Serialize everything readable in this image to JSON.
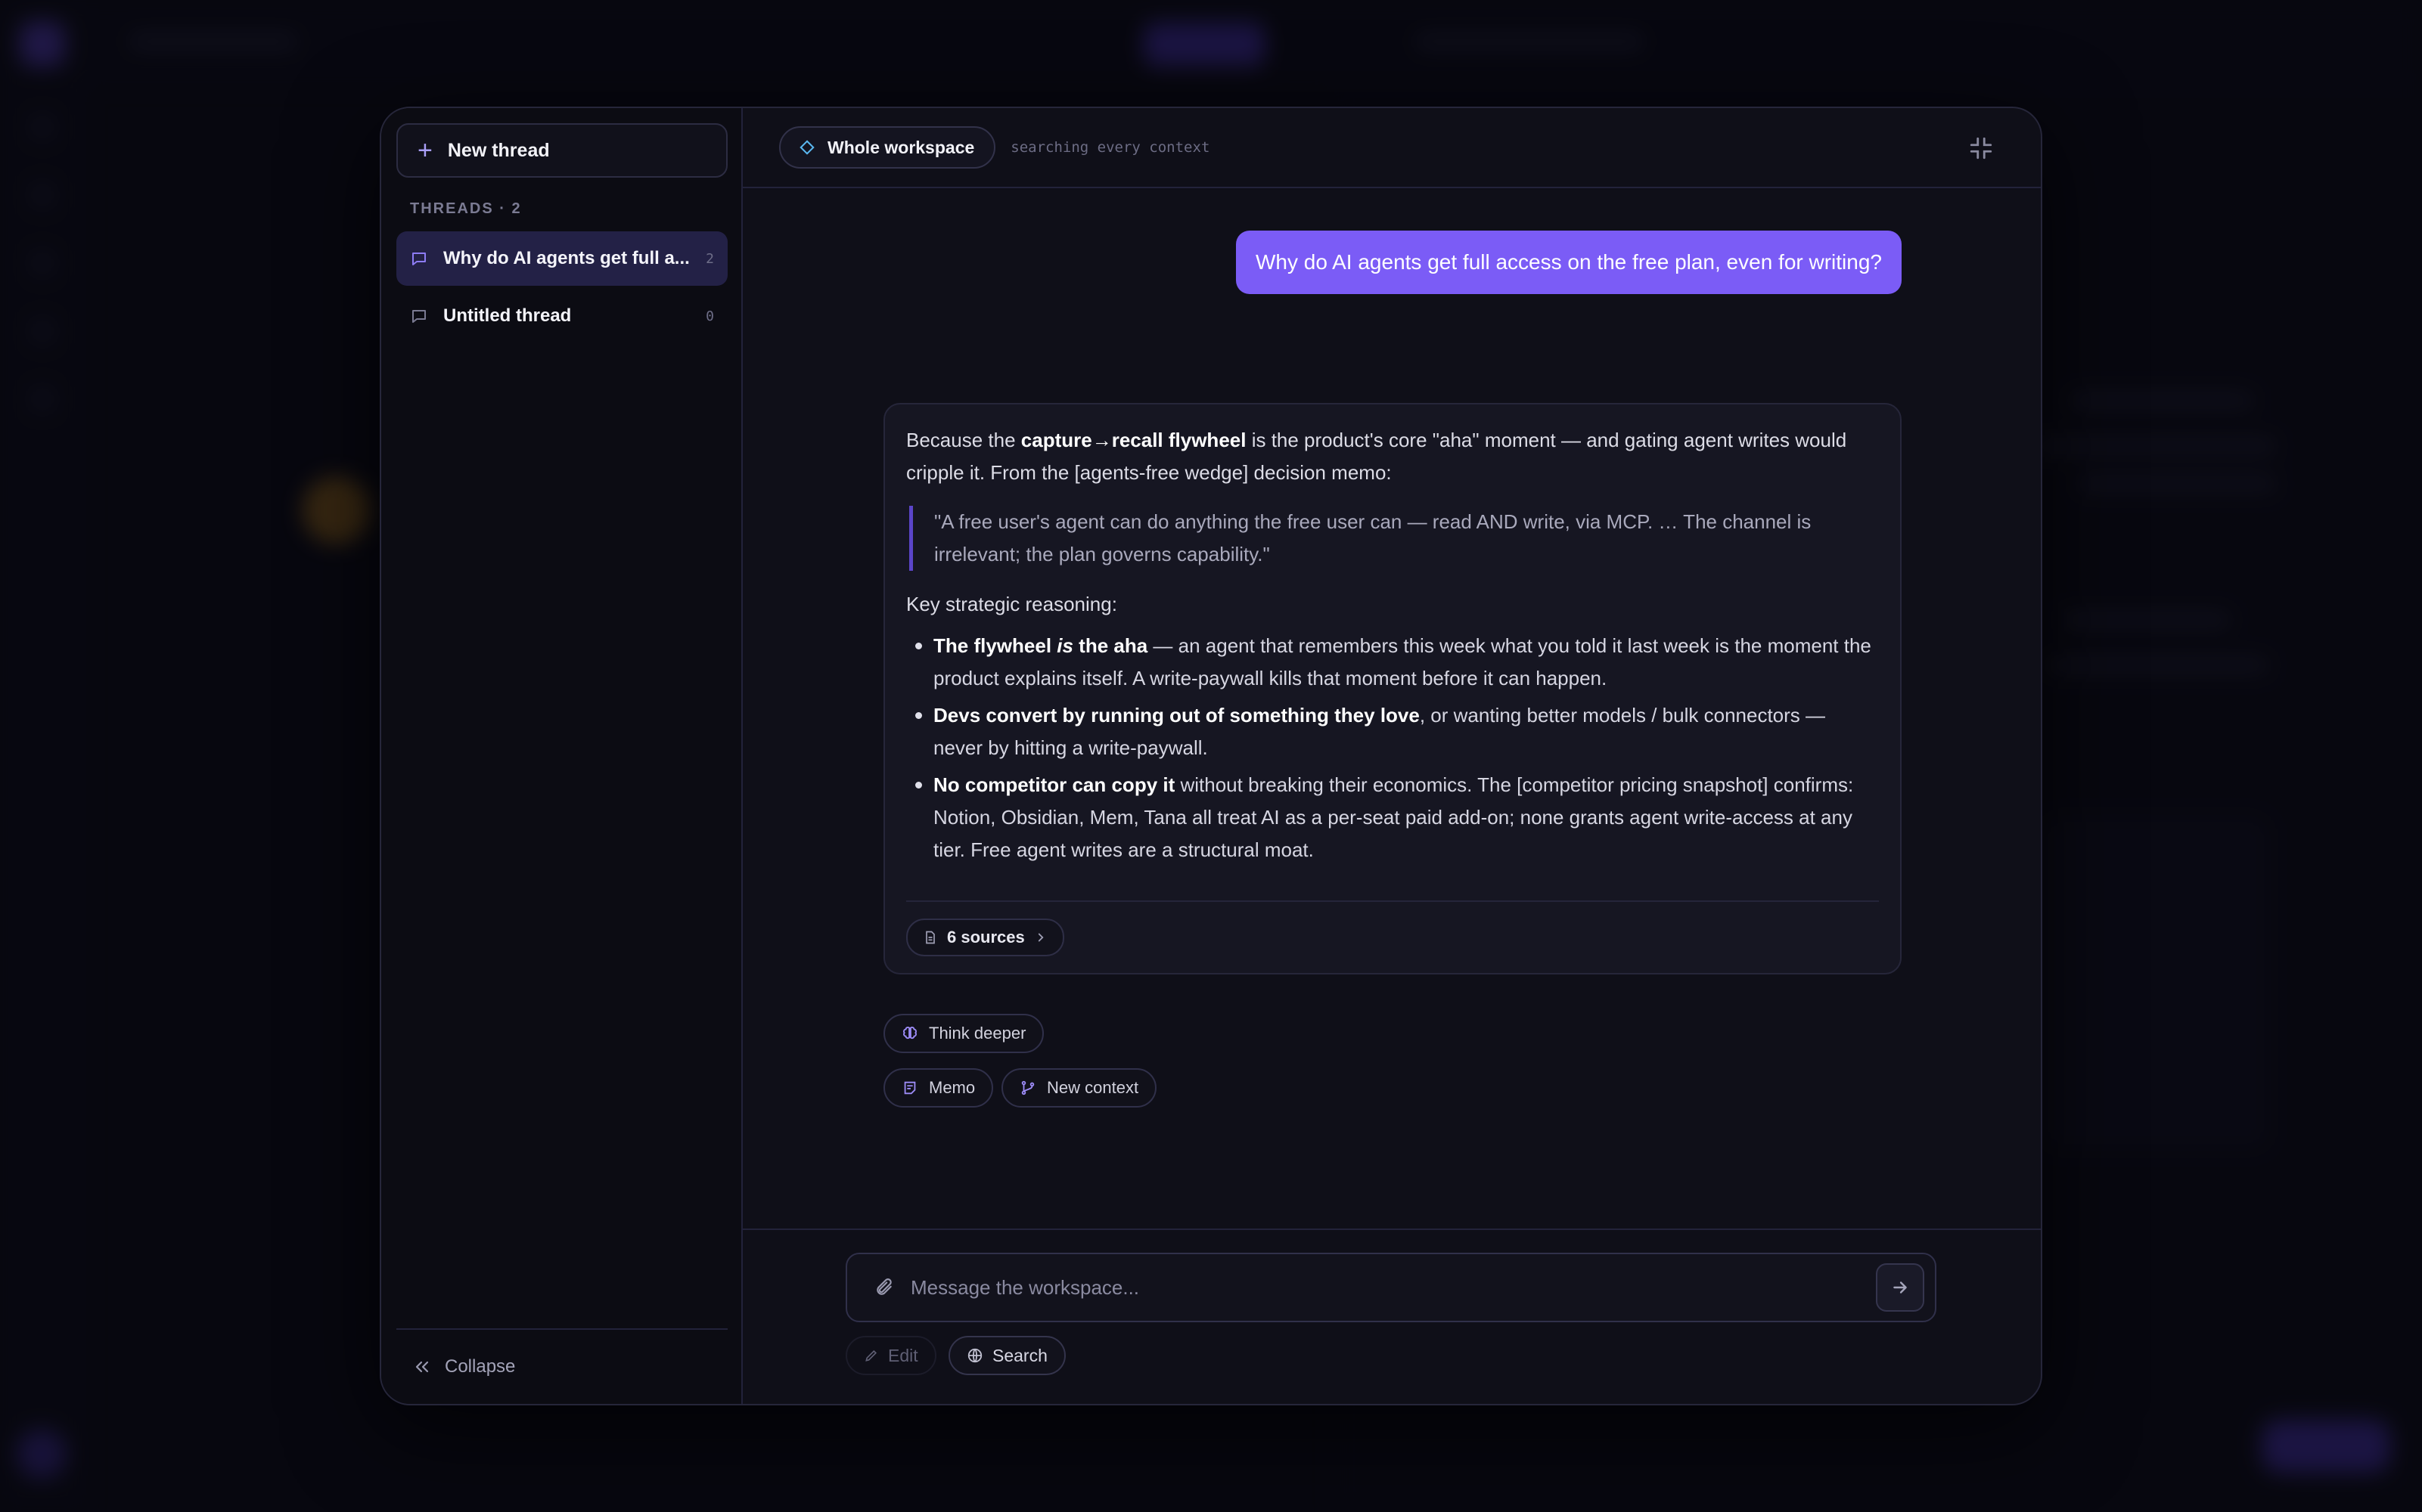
{
  "sidebar": {
    "new_thread_label": "New thread",
    "threads_header": "THREADS · 2",
    "threads": [
      {
        "title": "Why do AI agents get full a...",
        "count": "2",
        "active": true
      },
      {
        "title": "Untitled thread",
        "count": "0",
        "active": false
      }
    ],
    "collapse_label": "Collapse"
  },
  "header": {
    "scope_label": "Whole workspace",
    "scope_hint": "searching every context"
  },
  "conversation": {
    "user_message": "Why do AI agents get full access on the free plan, even for writing?",
    "answer": {
      "intro_1": "Because the ",
      "intro_bold": "capture→recall flywheel",
      "intro_2": " is the product's core \"aha\" moment — and gating agent writes would cripple it. From the [agents-free wedge] decision memo:",
      "quote": "\"A free user's agent can do anything the free user can — read AND write, via MCP. … The channel is irrelevant; the plan governs capability.\"",
      "key_label": "Key strategic reasoning:",
      "bullet_1_bold_a": "The flywheel ",
      "bullet_1_bold_em": "is",
      "bullet_1_bold_b": " the aha",
      "bullet_1_text": " — an agent that remembers this week what you told it last week is the moment the product explains itself. A write-paywall kills that moment before it can happen.",
      "bullet_2_bold": "Devs convert by running out of something they love",
      "bullet_2_text": ", or wanting better models / bulk connectors — never by hitting a write-paywall.",
      "bullet_3_bold": "No competitor can copy it",
      "bullet_3_text": " without breaking their economics. The [competitor pricing snapshot] confirms: Notion, Obsidian, Mem, Tana all treat AI as a per-seat paid add-on; none grants agent write-access at any tier. Free agent writes are a structural moat.",
      "sources_label": "6 sources"
    },
    "actions": {
      "think_deeper": "Think deeper",
      "memo": "Memo",
      "new_context": "New context"
    }
  },
  "composer": {
    "placeholder": "Message the workspace...",
    "edit_label": "Edit",
    "search_label": "Search"
  },
  "colors": {
    "accent": "#7b5cf6",
    "active_thread_bg": "#232146"
  }
}
